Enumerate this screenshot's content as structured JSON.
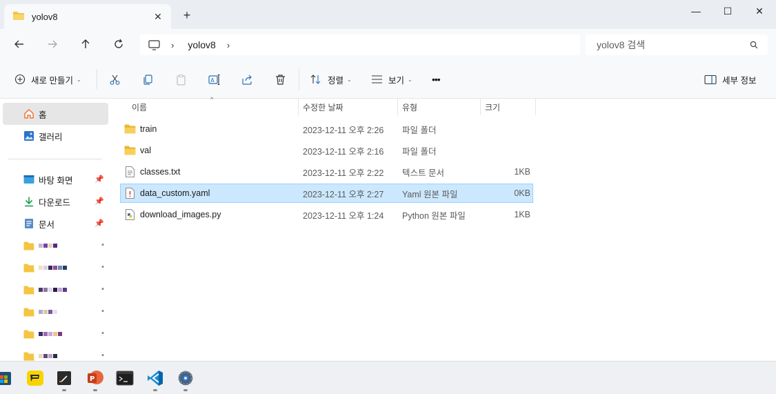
{
  "tab": {
    "title": "yolov8",
    "close": "✕",
    "new": "+"
  },
  "window_controls": {
    "minimize": "—",
    "maximize": "☐",
    "close": "✕"
  },
  "address": {
    "crumbs": [
      "yolov8"
    ]
  },
  "search": {
    "placeholder": "yolov8 검색"
  },
  "commands": {
    "new": "새로 만들기",
    "sort": "정렬",
    "view": "보기",
    "more": "•••",
    "details": "세부 정보"
  },
  "sidebar": {
    "home": "홈",
    "gallery": "갤러리",
    "pinned": [
      {
        "label": "바탕 화면",
        "icon": "desktop-icon"
      },
      {
        "label": "다운로드",
        "icon": "download-icon"
      },
      {
        "label": "문서",
        "icon": "document-icon"
      }
    ],
    "blurred_folders": 6
  },
  "columns": {
    "name": "이름",
    "modified": "수정한 날짜",
    "type": "유형",
    "size": "크기"
  },
  "files": [
    {
      "name": "train",
      "modified": "2023-12-11 오후 2:26",
      "type": "파일 폴더",
      "size": "",
      "icon": "folder-icon",
      "selected": false
    },
    {
      "name": "val",
      "modified": "2023-12-11 오후 2:16",
      "type": "파일 폴더",
      "size": "",
      "icon": "folder-icon",
      "selected": false
    },
    {
      "name": "classes.txt",
      "modified": "2023-12-11 오후 2:22",
      "type": "텍스트 문서",
      "size": "1KB",
      "icon": "text-file-icon",
      "selected": false
    },
    {
      "name": "data_custom.yaml",
      "modified": "2023-12-11 오후 2:27",
      "type": "Yaml 원본 파일",
      "size": "0KB",
      "icon": "yaml-file-icon",
      "selected": true
    },
    {
      "name": "download_images.py",
      "modified": "2023-12-11 오후 1:24",
      "type": "Python 원본 파일",
      "size": "1KB",
      "icon": "python-file-icon",
      "selected": false
    }
  ],
  "taskbar": [
    {
      "name": "store-app-icon",
      "color": "#1f4e79",
      "running": false
    },
    {
      "name": "kakaotalk-icon",
      "color": "#f7d400",
      "running": false
    },
    {
      "name": "terminal-app-icon",
      "color": "#2b2b2b",
      "running": true
    },
    {
      "name": "ppt-app-icon",
      "color": "#d24726",
      "running": true
    },
    {
      "name": "cmd-icon",
      "color": "#1e1e1e",
      "running": false
    },
    {
      "name": "vscode-icon",
      "color": "#007acc",
      "running": true
    },
    {
      "name": "settings-icon",
      "color": "#4a6078",
      "running": true
    }
  ],
  "colors": {
    "accent": "#0067c0",
    "selection": "#cce8ff",
    "folder": "#f4c542"
  }
}
